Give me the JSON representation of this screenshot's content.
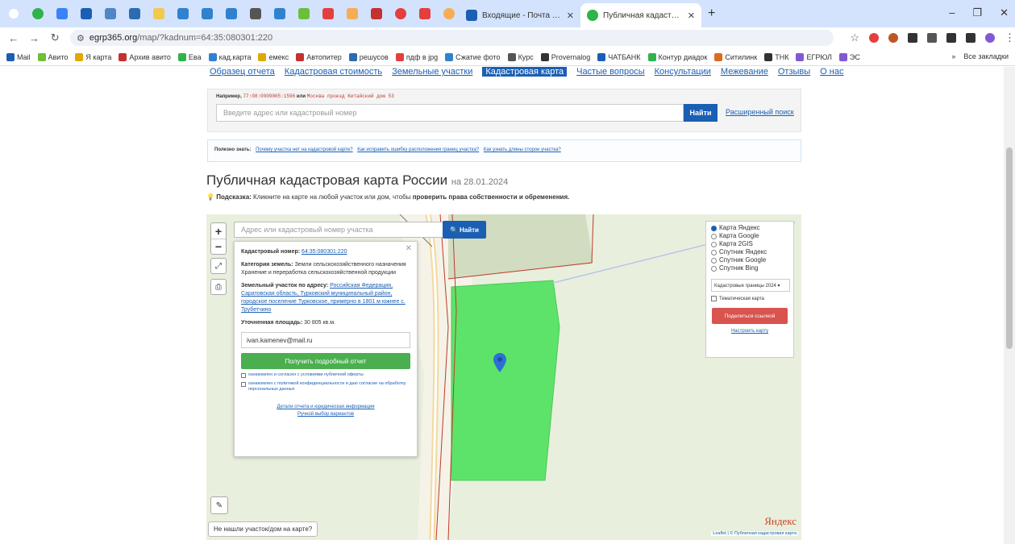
{
  "browser": {
    "tabs": [
      {
        "title": "Входящие - Почта Mail.ru",
        "active": false
      },
      {
        "title": "Публичная кадастровая карта",
        "active": true
      }
    ],
    "url_host": "egrp365.org",
    "url_path": "/map/?kadnum=64:35:080301:220",
    "bookmarks": [
      "Mail",
      "Авито",
      "Я карта",
      "Архив авито",
      "Ева",
      "кад.карта",
      "емекс",
      "Автопитер",
      "решусов",
      "пдф в jpg",
      "Сжатие фото",
      "Курс",
      "Provernalog",
      "ЧАТБАНК",
      "Контур диадок",
      "Ситилинк",
      "ТНК",
      "ЕГРЮЛ",
      "ЭС"
    ],
    "bookmarks_all": "Все закладки",
    "colors": {
      "tabbar": "#d3e3fd",
      "accent": "#1a5fb4"
    }
  },
  "site": {
    "nav": [
      "Образец отчета",
      "Кадастровая стоимость",
      "Земельные участки",
      "Кадастровая карта",
      "Частые вопросы",
      "Консультации",
      "Межевание",
      "Отзывы",
      "О нас"
    ],
    "nav_active_index": 3,
    "example_label": "Например,",
    "example_num": "77:08:0009005:1596",
    "example_or": "или",
    "example_addr": "Москва проезд Китайский дом 53",
    "search_placeholder": "Введите адрес или кадастровый номер",
    "search_button": "Найти",
    "advanced_search": "Расширенный поиск",
    "tips_label": "Полезно знать:",
    "tips": [
      "Почему участка нет на кадастровой карте?",
      "Как исправить ошибку расположения границ участка?",
      "Как узнать длины сторон участка?"
    ],
    "title": "Публичная кадастровая карта России",
    "title_date": "на 28.01.2024",
    "hint_label": "Подсказка:",
    "hint_text": "Кликните на карте на любой участок или дом, чтобы",
    "hint_bold": "проверить права собственности и обременения."
  },
  "map": {
    "search_placeholder": "Адрес или кадастровый номер участка",
    "search_button": "Найти",
    "popup": {
      "cad_label": "Кадастровый номер:",
      "cad_value": "64:35:080301:220",
      "category_label": "Категория земель:",
      "category_value": "Земли сельскохозяйственного назначения",
      "use_value": "Хранение и переработка сельскохозяйственной продукции",
      "address_label": "Земельный участок по адресу:",
      "address_value": "Российская Федерация, Саратовская область, Турковский муниципальный район, городское поселение Турковское, примерно в 1801 м южнее с. Трубетчино",
      "area_label": "Уточненная площадь:",
      "area_value": "30 805 кв.м.",
      "email": "ivan.kamenev@mail.ru",
      "report_button": "Получить подробный отчет",
      "check1": "ознакомлен и согласен с условиями публичной оферты",
      "check2": "ознакомлен с политикой конфиденциальности и даю согласие на обработку персональных данных",
      "details_link": "Детали отчета и юридическая информация",
      "manual_link": "Ручной выбор вариантов"
    },
    "layers": [
      "Карта Яндекс",
      "Карта Google",
      "Карта 2GIS",
      "Спутник Яндекс",
      "Спутник Google",
      "Спутник Bing"
    ],
    "layers_selected_index": 0,
    "borders_select": "Кадастровые границы 2024",
    "thematic_label": "Тематическая карта",
    "share_button": "Поделиться ссылкой",
    "setup_link": "Настроить карту",
    "not_found": "Не нашли участок/дом на карте?",
    "provider": "Яндекс",
    "attribution": "Leaflet | © Публичная кадастровая карта",
    "plot_color": "#5ee36a"
  }
}
